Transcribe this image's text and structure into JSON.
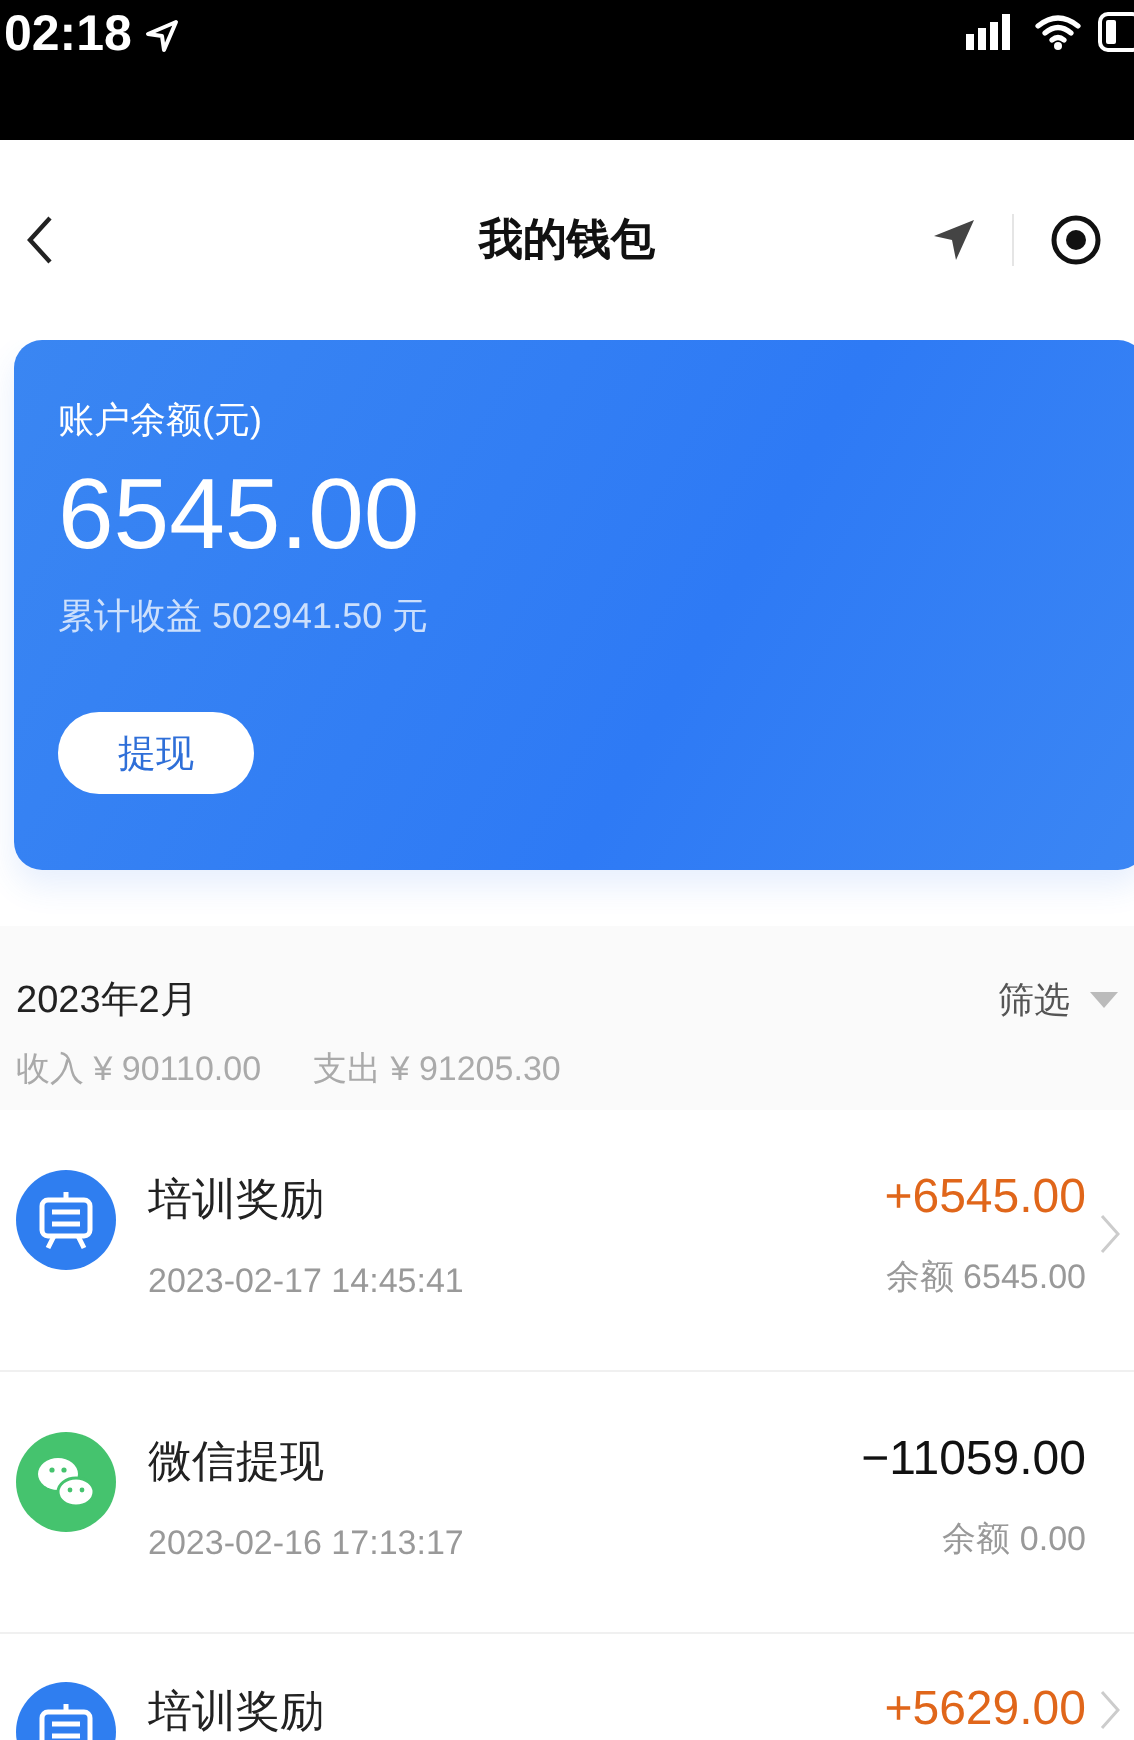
{
  "status_bar": {
    "time": "02:18"
  },
  "nav": {
    "title": "我的钱包"
  },
  "balance_card": {
    "label": "账户余额(元)",
    "amount": "6545.00",
    "cumulative": "累计收益 502941.50 元",
    "button": "提现"
  },
  "month": {
    "title": "2023年2月",
    "filter": "筛选",
    "income": "收入 ¥ 90110.00",
    "expense": "支出 ¥ 91205.30"
  },
  "transactions": [
    {
      "kind": "training",
      "title": "培训奖励",
      "time": "2023-02-17 14:45:41",
      "amount": "+6545.00",
      "color": "#e0661a",
      "balance": "余额 6545.00",
      "arrow": true
    },
    {
      "kind": "wechat",
      "title": "微信提现",
      "time": "2023-02-16 17:13:17",
      "amount": "−11059.00",
      "color": "#111111",
      "balance": "余额 0.00",
      "arrow": false
    },
    {
      "kind": "training",
      "title": "培训奖励",
      "amount": "+5629.00",
      "color": "#e0661a",
      "arrow": true
    }
  ]
}
